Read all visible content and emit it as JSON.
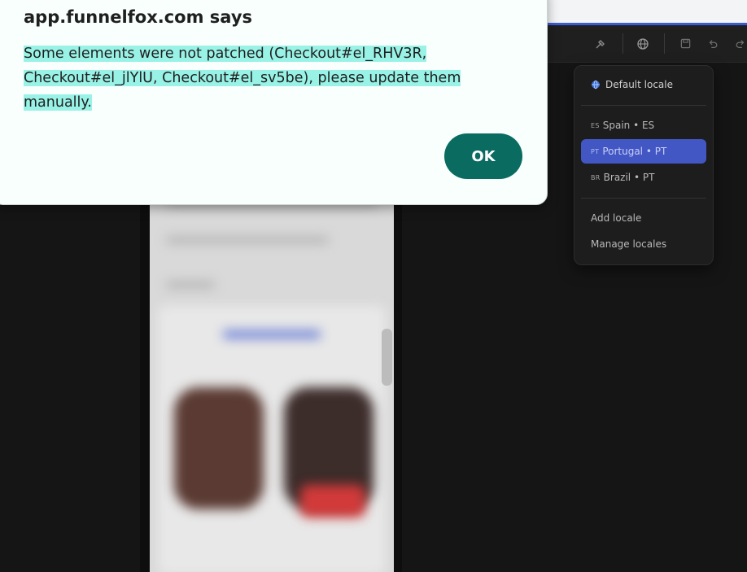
{
  "dialog": {
    "title": "app.funnelfox.com says",
    "message_line1": "Some elements were not patched (Checkout#el_RHV3R,",
    "message_line2": "Checkout#el_jlYlU, Checkout#el_sv5be), please update them manually.",
    "ok_label": "OK"
  },
  "toolbar": {
    "icons": [
      "brush-icon",
      "globe-icon",
      "save-icon",
      "undo-icon",
      "redo-icon"
    ]
  },
  "locale_menu": {
    "default_label": "Default locale",
    "items": [
      {
        "code": "ES",
        "label": "Spain • ES"
      },
      {
        "code": "PT",
        "label": "Portugal • PT",
        "active": true
      },
      {
        "code": "BR",
        "label": "Brazil • PT"
      }
    ],
    "add_label": "Add locale",
    "manage_label": "Manage locales"
  },
  "colors": {
    "accent": "#4357c4",
    "ok_button": "#0a6b61",
    "highlight": "#99f2e6"
  }
}
